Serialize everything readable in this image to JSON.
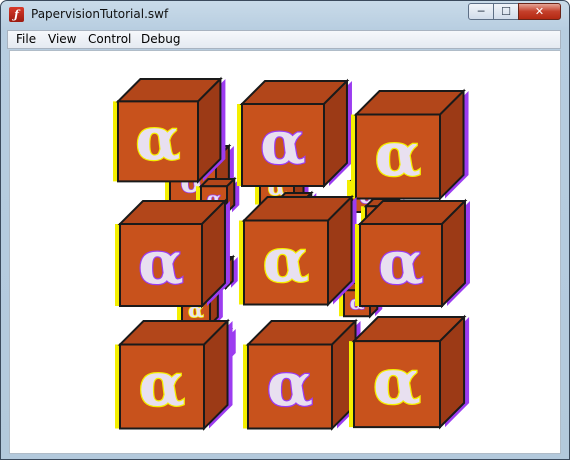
{
  "window": {
    "title": "PapervisionTutorial.swf"
  },
  "titlebar": {
    "min_glyph": "─",
    "max_glyph": "☐",
    "close_glyph": "✕"
  },
  "menu": {
    "items": [
      "File",
      "View",
      "Control",
      "Debug"
    ]
  },
  "stage": {
    "cube_glyph": "α",
    "colors": {
      "face": "#c8521c",
      "edge": "#1a1a1a",
      "ghost_yellow": "#f4ef00",
      "ghost_violet": "#9c3cf0"
    }
  }
}
